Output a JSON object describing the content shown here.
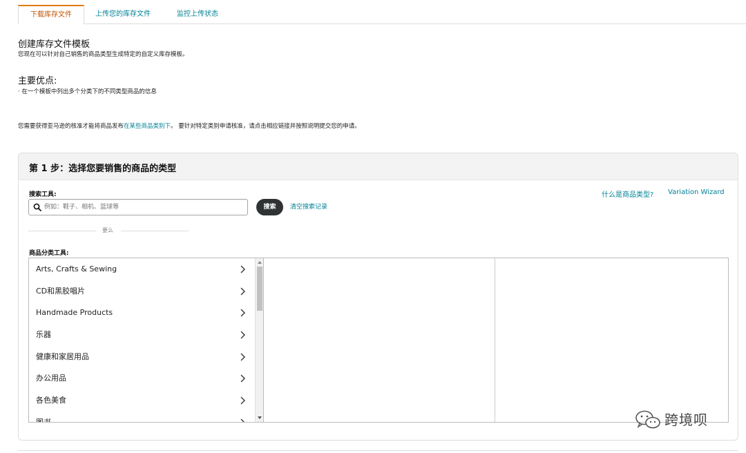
{
  "tabs": [
    {
      "label": "下载库存文件",
      "active": true
    },
    {
      "label": "上传您的库存文件",
      "active": false
    },
    {
      "label": "监控上传状态",
      "active": false
    }
  ],
  "intro": {
    "title": "创建库存文件模板",
    "description": "您现在可以针对自己销售的商品类型生成特定的自定义库存模板。",
    "advantages_title": "主要优点:",
    "advantages": [
      "· 在一个模板中列出多个分类下的不同类型商品的信息"
    ],
    "notice_before": "您需要获得亚马逊的核准才能将商品发布",
    "notice_link": "在某些商品类别下",
    "notice_after": "。 要针对特定类别申请核准，请点击相应链接并按照说明提交您的申请。"
  },
  "step1": {
    "title": "第 1 步：选择您要销售的商品的类型",
    "search_label": "搜索工具:",
    "search_placeholder": "例如：鞋子、相机、篮球等",
    "search_button": "搜索",
    "clear_history": "清空搜索记录",
    "help_link": "什么是商品类型?",
    "variation_wizard": "Variation Wizard",
    "or_text": "要么",
    "category_label": "商品分类工具:",
    "categories": [
      "Arts, Crafts & Sewing",
      "CD和黑胶唱片",
      "Handmade Products",
      "乐器",
      "健康和家居用品",
      "办公用品",
      "各色美食",
      "图书"
    ]
  },
  "watermark": {
    "text": "跨境呗",
    "icon": "wechat-icon"
  },
  "colors": {
    "accent": "#e47911",
    "link": "#008296",
    "active_tab_text": "#c45500"
  }
}
